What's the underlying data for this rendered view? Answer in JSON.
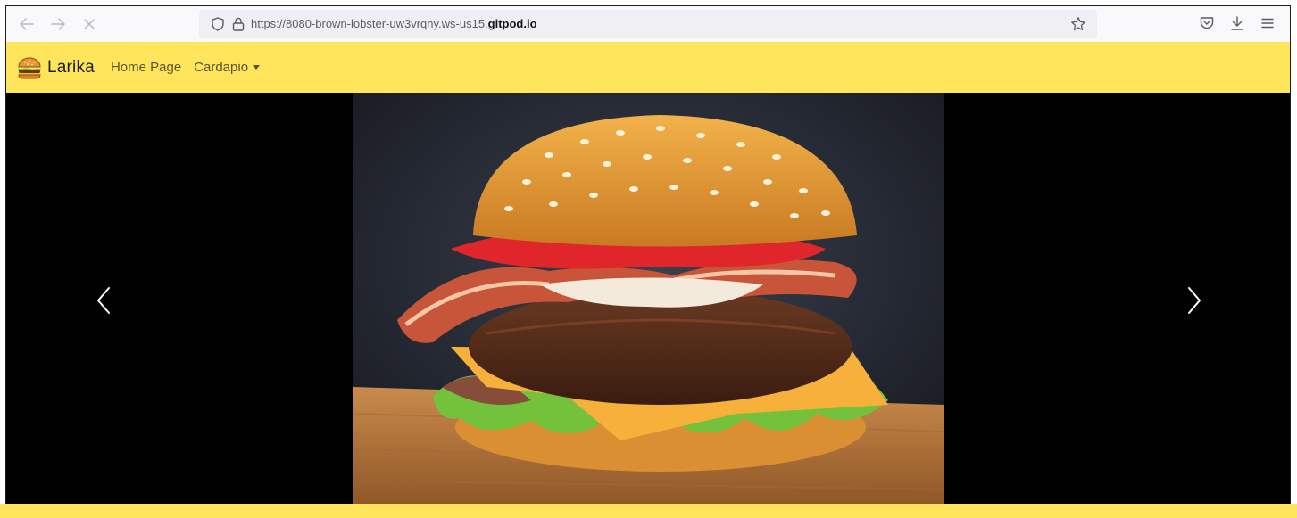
{
  "browser": {
    "url_prefix": "https://8080-brown-lobster-uw3vrqny.ws-us15.",
    "url_host": "gitpod.io",
    "icons": {
      "back": "arrow-left-icon",
      "forward": "arrow-right-icon",
      "stop": "close-icon",
      "tracking": "shield-icon",
      "security": "lock-icon",
      "bookmark": "star-icon",
      "pocket": "pocket-icon",
      "downloads": "download-icon",
      "menu": "hamburger-menu-icon"
    }
  },
  "navbar": {
    "brand": "Larika",
    "links": [
      {
        "label": "Home Page"
      },
      {
        "label": "Cardapio",
        "dropdown": true
      }
    ],
    "background": "#ffe55c"
  },
  "carousel": {
    "prev_icon": "chevron-left-icon",
    "next_icon": "chevron-right-icon",
    "slide_image": "burger-photo"
  }
}
